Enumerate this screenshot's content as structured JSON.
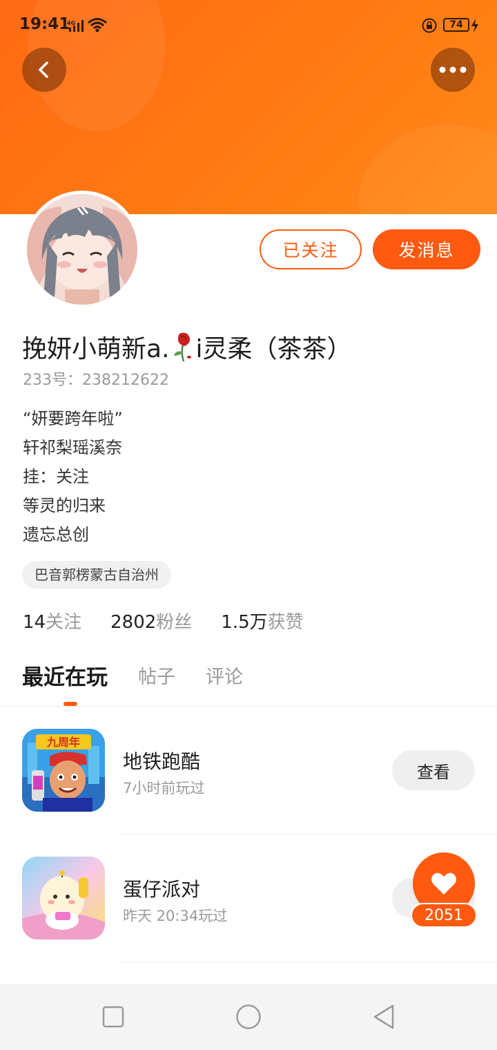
{
  "status_bar": {
    "time": "19:41",
    "network": "4G",
    "battery": "74"
  },
  "header": {
    "back_icon": "chevron-left-icon",
    "more_icon": "more-dots-icon",
    "accent_color": "#ff6a14"
  },
  "profile": {
    "follow_label": "已关注",
    "message_label": "发消息",
    "name_before": "挽妍小萌新a.",
    "name_emoji": "wilted-rose-icon",
    "name_after": "i灵柔（茶茶）",
    "uid_label": "233号：",
    "uid": "238212622",
    "bio": [
      "“妍要跨年啦”",
      "轩祁梨瑶溪奈",
      "挂：关注",
      "等灵的归来",
      "遗忘总创"
    ],
    "location": "巴音郭楞蒙古自治州"
  },
  "stats": [
    {
      "value": "14",
      "label": "关注"
    },
    {
      "value": "2802",
      "label": "粉丝"
    },
    {
      "value": "1.5万",
      "label": "获赞"
    }
  ],
  "tabs": [
    {
      "label": "最近在玩"
    },
    {
      "label": "帖子"
    },
    {
      "label": "评论"
    }
  ],
  "games": [
    {
      "name": "地铁跑酷",
      "played": "7小时前玩过",
      "button": "查看"
    },
    {
      "name": "蛋仔派对",
      "played": "昨天 20:34玩过",
      "button": "查看"
    }
  ],
  "like": {
    "icon": "heart-icon",
    "count": "2051"
  },
  "nav": {
    "square_icon": "square-icon",
    "home_icon": "circle-icon",
    "back_icon": "triangle-back-icon"
  }
}
